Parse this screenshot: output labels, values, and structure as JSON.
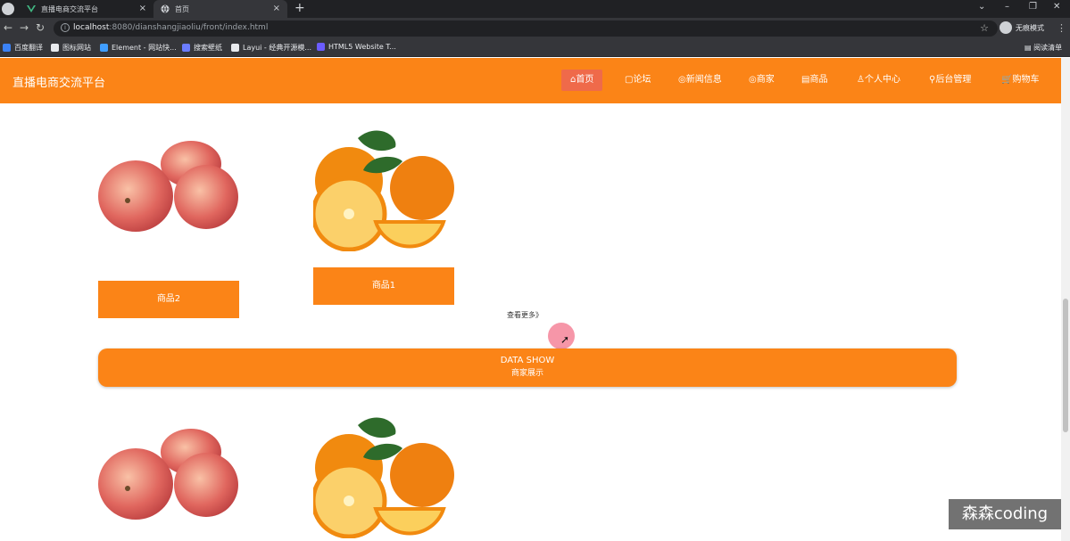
{
  "browser": {
    "tabs": [
      {
        "title": "直播电商交流平台",
        "active": false
      },
      {
        "title": "首页",
        "active": true
      }
    ],
    "new_tab": "+",
    "url_host": "localhost",
    "url_rest": ":8080/dianshangjiaoliu/front/index.html",
    "incognito_label": "无痕模式",
    "bookmarks": [
      "百度翻译",
      "图标网站",
      "Element - 网站快...",
      "搜索壁纸",
      "Layui - 经典开源模...",
      "HTML5 Website T..."
    ],
    "reading_list": "阅读清单"
  },
  "site": {
    "brand": "直播电商交流平台",
    "nav": [
      "首页",
      "论坛",
      "新闻信息",
      "商家",
      "商品",
      "个人中心",
      "后台管理",
      "购物车"
    ],
    "active_nav": "首页"
  },
  "products": [
    {
      "name": "商品2",
      "image": "apple"
    },
    {
      "name": "商品1",
      "image": "orange"
    }
  ],
  "more_link": "查看更多》",
  "banner": {
    "title": "DATA SHOW",
    "subtitle": "商家展示"
  },
  "products_bottom": [
    {
      "image": "apple"
    },
    {
      "image": "orange"
    }
  ],
  "watermark": "森森coding",
  "colors": {
    "accent": "#fb8417",
    "active_nav": "#ef6a4a"
  }
}
